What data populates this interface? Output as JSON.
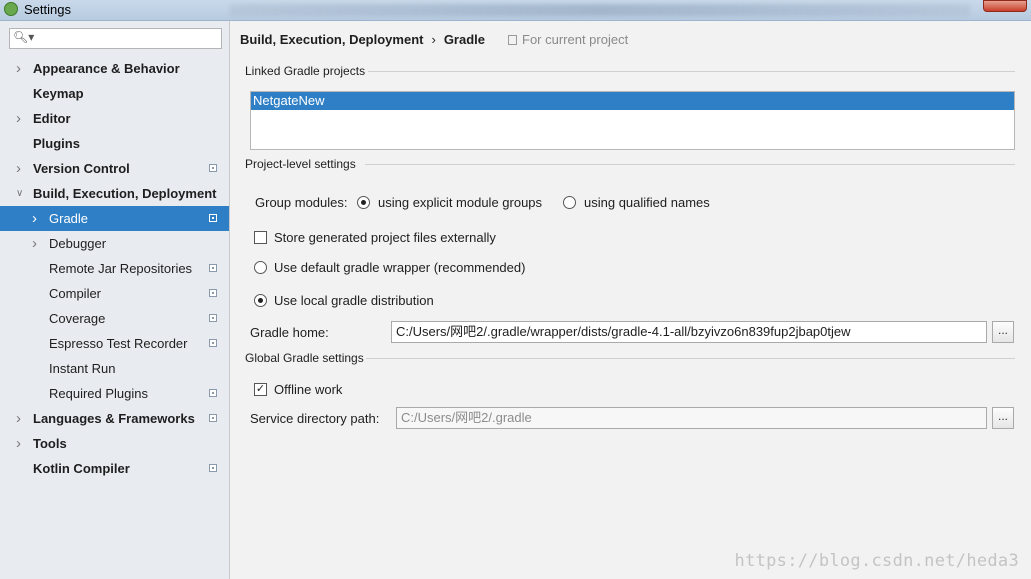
{
  "window": {
    "title": "Settings"
  },
  "sidebar": {
    "search_placeholder": "",
    "items": [
      {
        "label": "Appearance & Behavior",
        "bold": true,
        "level": 0,
        "arrow": true,
        "pi": false
      },
      {
        "label": "Keymap",
        "bold": true,
        "level": 0,
        "arrow": false,
        "pi": false
      },
      {
        "label": "Editor",
        "bold": true,
        "level": 0,
        "arrow": true,
        "pi": false
      },
      {
        "label": "Plugins",
        "bold": true,
        "level": 0,
        "arrow": false,
        "pi": false
      },
      {
        "label": "Version Control",
        "bold": true,
        "level": 0,
        "arrow": true,
        "pi": true
      },
      {
        "label": "Build, Execution, Deployment",
        "bold": true,
        "level": 0,
        "arrow": true,
        "expanded": true,
        "pi": false
      },
      {
        "label": "Gradle",
        "bold": false,
        "level": 1,
        "arrow": true,
        "pi": true,
        "selected": true
      },
      {
        "label": "Debugger",
        "bold": false,
        "level": 1,
        "arrow": true,
        "pi": false
      },
      {
        "label": "Remote Jar Repositories",
        "bold": false,
        "level": 1,
        "arrow": false,
        "pi": true
      },
      {
        "label": "Compiler",
        "bold": false,
        "level": 1,
        "arrow": false,
        "pi": true
      },
      {
        "label": "Coverage",
        "bold": false,
        "level": 1,
        "arrow": false,
        "pi": true
      },
      {
        "label": "Espresso Test Recorder",
        "bold": false,
        "level": 1,
        "arrow": false,
        "pi": true
      },
      {
        "label": "Instant Run",
        "bold": false,
        "level": 1,
        "arrow": false,
        "pi": false
      },
      {
        "label": "Required Plugins",
        "bold": false,
        "level": 1,
        "arrow": false,
        "pi": true
      },
      {
        "label": "Languages & Frameworks",
        "bold": true,
        "level": 0,
        "arrow": true,
        "pi": true
      },
      {
        "label": "Tools",
        "bold": true,
        "level": 0,
        "arrow": true,
        "pi": false
      },
      {
        "label": "Kotlin Compiler",
        "bold": true,
        "level": 0,
        "arrow": false,
        "pi": true
      }
    ]
  },
  "breadcrumb": {
    "parent": "Build, Execution, Deployment",
    "separator": "›",
    "current": "Gradle",
    "scope": "For current project"
  },
  "linked_projects": {
    "title": "Linked Gradle projects",
    "items": [
      "NetgateNew"
    ]
  },
  "project_settings": {
    "title": "Project-level settings",
    "group_modules_label": "Group modules:",
    "group_option_explicit": "using explicit module groups",
    "group_option_qualified": "using qualified names",
    "store_external_label": "Store generated project files externally",
    "default_wrapper_label": "Use default gradle wrapper (recommended)",
    "local_distribution_label": "Use local gradle distribution",
    "gradle_home_label": "Gradle home:",
    "gradle_home_value": "C:/Users/网吧2/.gradle/wrapper/dists/gradle-4.1-all/bzyivzo6n839fup2jbap0tjew"
  },
  "global_settings": {
    "title": "Global Gradle settings",
    "offline_label": "Offline work",
    "offline_checked": true,
    "service_dir_label": "Service directory path:",
    "service_dir_value": "C:/Users/网吧2/.gradle"
  },
  "browse_label": "...",
  "watermark": "https://blog.csdn.net/heda3"
}
